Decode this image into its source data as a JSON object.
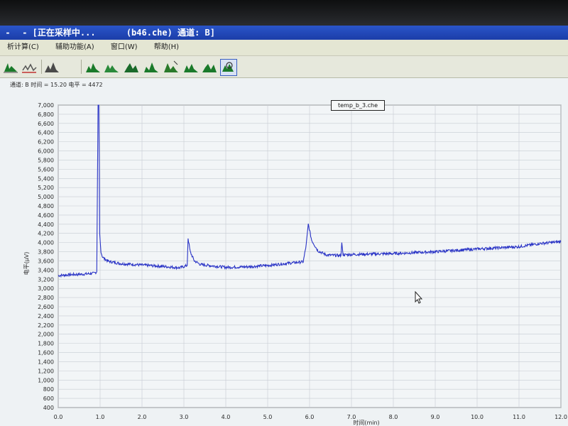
{
  "window": {
    "title_prefix": "- [正在采样中...",
    "title_file": "(b46.che)",
    "title_channel": "通道: B]"
  },
  "menu": [
    {
      "label": "析计算(C)"
    },
    {
      "label": "辅助功能(A)"
    },
    {
      "label": "窗口(W)"
    },
    {
      "label": "帮助(H)"
    }
  ],
  "toolbar": {
    "buttons": [
      {
        "name": "peak-calc-icon"
      },
      {
        "name": "baseline-icon"
      },
      {
        "name": "chromatogram-view-1-icon"
      },
      {
        "name": "chromatogram-view-2-icon"
      },
      {
        "name": "chromatogram-view-3-icon"
      },
      {
        "name": "chromatogram-view-4-icon"
      },
      {
        "name": "chromatogram-view-5-icon"
      },
      {
        "name": "chromatogram-view-6-icon"
      },
      {
        "name": "chromatogram-view-7-icon"
      },
      {
        "name": "zoom-chromatogram-icon"
      }
    ],
    "peak_color": "#1a7a2a",
    "accent_color": "#3a5fc0"
  },
  "readout": "通道: B 时间 = 15.20 电平 = 4472",
  "file_label": "temp_b_3.che",
  "chart_data": {
    "type": "line",
    "title": "",
    "xlabel": "时间(min)",
    "ylabel": "电平(μV)",
    "xlim": [
      0,
      12
    ],
    "ylim": [
      400,
      7000
    ],
    "xticks": [
      "0.0",
      "1.0",
      "2.0",
      "3.0",
      "4.0",
      "5.0",
      "6.0",
      "7.0",
      "8.0",
      "9.0",
      "10.0",
      "11.0",
      "12.0"
    ],
    "yticks": [
      "400",
      "600",
      "800",
      "1,000",
      "1,200",
      "1,400",
      "1,600",
      "1,800",
      "2,000",
      "2,200",
      "2,400",
      "2,600",
      "2,800",
      "3,000",
      "3,200",
      "3,400",
      "3,600",
      "3,800",
      "4,000",
      "4,200",
      "4,400",
      "4,600",
      "4,800",
      "5,000",
      "5,200",
      "5,400",
      "5,600",
      "5,800",
      "6,000",
      "6,200",
      "6,400",
      "6,600",
      "6,800",
      "7,000"
    ],
    "grid": true,
    "line_color": "#2a34c6",
    "series": [
      {
        "x": [
          0.0,
          0.3,
          0.6,
          0.85,
          0.92,
          0.95,
          0.97,
          0.99,
          1.02,
          1.05,
          1.1,
          1.2,
          1.5,
          2.0,
          2.5,
          2.9,
          3.08,
          3.1,
          3.15,
          3.25,
          3.4,
          4.0,
          4.5,
          5.0,
          5.5,
          5.85,
          5.92,
          5.97,
          6.05,
          6.2,
          6.4,
          6.6,
          6.75,
          6.77,
          6.8,
          7.0,
          8.0,
          9.0,
          10.0,
          11.0,
          11.5,
          12.0
        ],
        "y": [
          3280,
          3300,
          3310,
          3330,
          3360,
          7000,
          7000,
          4200,
          3780,
          3700,
          3650,
          3590,
          3540,
          3510,
          3480,
          3450,
          3500,
          4100,
          3800,
          3600,
          3520,
          3460,
          3470,
          3500,
          3550,
          3580,
          3950,
          4400,
          4050,
          3820,
          3730,
          3720,
          3720,
          4000,
          3730,
          3740,
          3760,
          3800,
          3860,
          3910,
          3980,
          4020
        ]
      }
    ]
  }
}
